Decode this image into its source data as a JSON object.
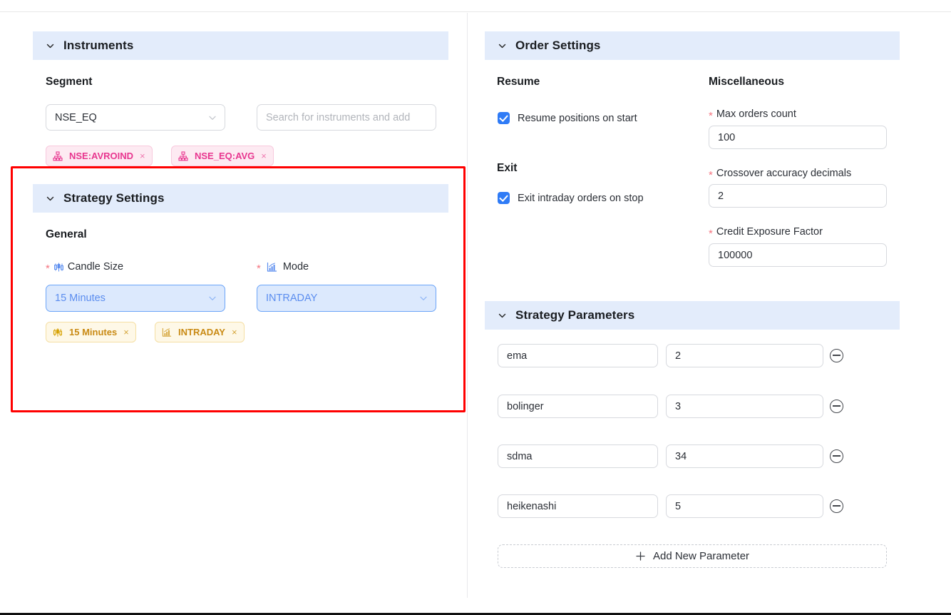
{
  "panels": {
    "instruments": {
      "title": "Instruments",
      "caret": "chevron-down-icon",
      "segment_label": "Segment",
      "segment_value": "NSE_EQ",
      "search_placeholder": "Search for instruments and add",
      "chips": [
        {
          "icon": "sitemap-icon",
          "label": "NSE:AVROIND",
          "remove": "×"
        },
        {
          "icon": "sitemap-icon",
          "label": "NSE_EQ:AVG",
          "remove": "×"
        }
      ]
    },
    "strategy_settings": {
      "title": "Strategy Settings",
      "caret": "chevron-down-icon",
      "group_label": "General",
      "fields": [
        {
          "required": "*",
          "icon": "candlestick-icon",
          "label": "Candle Size",
          "value": "15 Minutes"
        },
        {
          "required": "*",
          "icon": "bar-chart-arrow-icon",
          "label": "Mode",
          "value": "INTRADAY"
        }
      ],
      "chips": [
        {
          "icon": "candlestick-icon",
          "label": "15 Minutes",
          "remove": "×"
        },
        {
          "icon": "bar-chart-arrow-icon",
          "label": "INTRADAY",
          "remove": "×"
        }
      ]
    },
    "order_settings": {
      "title": "Order Settings",
      "caret": "chevron-down-icon",
      "resume_group": "Resume",
      "exit_group": "Exit",
      "misc_group": "Miscellaneous",
      "checkboxes": [
        {
          "label": "Resume positions on start",
          "checked": true
        },
        {
          "label": "Exit intraday orders on stop",
          "checked": true
        }
      ],
      "misc_fields": [
        {
          "required": "*",
          "label": "Max orders count",
          "value": "100"
        },
        {
          "required": "*",
          "label": "Crossover accuracy decimals",
          "value": "2"
        },
        {
          "required": "*",
          "label": "Credit Exposure Factor",
          "value": "100000"
        }
      ]
    },
    "strategy_parameters": {
      "title": "Strategy Parameters",
      "caret": "chevron-down-icon",
      "rows": [
        {
          "name": "ema",
          "value": "2",
          "remove_icon": "minus-circle-icon"
        },
        {
          "name": "bolinger",
          "value": "3",
          "remove_icon": "minus-circle-icon"
        },
        {
          "name": "sdma",
          "value": "34",
          "remove_icon": "minus-circle-icon"
        },
        {
          "name": "heikenashi",
          "value": "5",
          "remove_icon": "minus-circle-icon"
        }
      ],
      "add_label": "Add New Parameter",
      "add_icon": "plus-icon"
    }
  },
  "colors": {
    "panel_header_bg": "#e3ecfb",
    "accent_blue": "#2f7bf6",
    "chip_pink_text": "#e8368f",
    "chip_amber_text": "#c98a14",
    "required_red": "#f5737f",
    "highlight_red": "#ff0000"
  }
}
